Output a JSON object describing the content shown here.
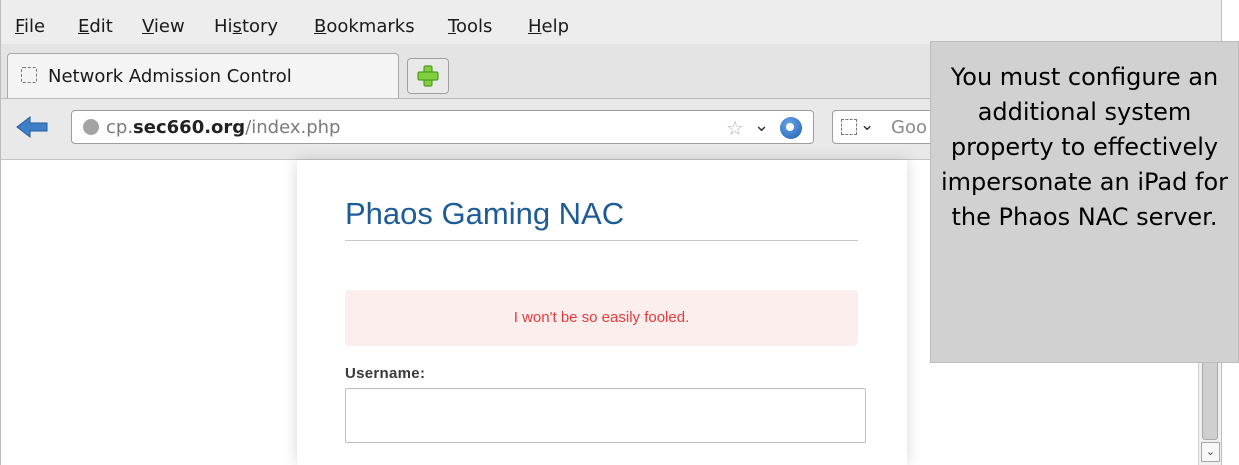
{
  "menubar": {
    "items": [
      {
        "label": "File",
        "mnemonic": "F"
      },
      {
        "label": "Edit",
        "mnemonic": "E"
      },
      {
        "label": "View",
        "mnemonic": "V"
      },
      {
        "label": "History",
        "mnemonic": "s"
      },
      {
        "label": "Bookmarks",
        "mnemonic": "B"
      },
      {
        "label": "Tools",
        "mnemonic": "T"
      },
      {
        "label": "Help",
        "mnemonic": "H"
      }
    ]
  },
  "tabs": [
    {
      "title": "Network Admission Control",
      "icon": "blank-page-icon"
    }
  ],
  "newtab": {
    "icon": "plus-icon"
  },
  "navbar": {
    "url_prefix": "cp.",
    "url_domain": "sec660.org",
    "url_path": "/index.php",
    "search_placeholder": "Goo"
  },
  "page": {
    "title": "Phaos Gaming NAC",
    "alert": "I won't be so easily fooled.",
    "username_label": "Username:",
    "username_value": ""
  },
  "callout": {
    "text": "You must configure an additional system property to effectively impersonate an iPad for the Phaos NAC server."
  },
  "colors": {
    "title": "#1d5c99",
    "alert_text": "#e53b3b",
    "alert_bg": "#fdeeee",
    "callout_bg": "#d1d1d1"
  }
}
